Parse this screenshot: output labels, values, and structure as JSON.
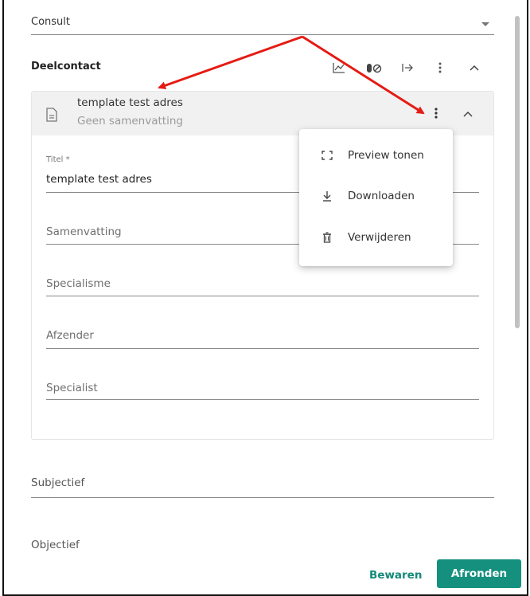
{
  "consult": {
    "value": "Consult"
  },
  "section": {
    "title": "Deelcontact",
    "header_icons": [
      "chart-icon",
      "pill-off-icon",
      "export-icon",
      "more-vert-icon",
      "chevron-up-icon"
    ]
  },
  "document": {
    "title": "template test adres",
    "summary": "Geen samenvatting",
    "fields": {
      "titel_label": "Titel *",
      "titel_value": "template test adres",
      "samenvatting_label": "Samenvatting",
      "specialisme_label": "Specialisme",
      "afzender_label": "Afzender",
      "specialist_label": "Specialist"
    }
  },
  "context_menu": {
    "items": [
      {
        "label": "Preview tonen",
        "icon": "fullscreen-icon"
      },
      {
        "label": "Downloaden",
        "icon": "download-icon"
      },
      {
        "label": "Verwijderen",
        "icon": "trash-icon"
      }
    ]
  },
  "soep": {
    "subjectief_label": "Subjectief",
    "objectief_label": "Objectief"
  },
  "footer": {
    "save_label": "Bewaren",
    "finish_label": "Afronden"
  },
  "colors": {
    "accent": "#15907f",
    "annotation_arrow": "#e51b14",
    "header_bg": "#f1f1f1"
  }
}
